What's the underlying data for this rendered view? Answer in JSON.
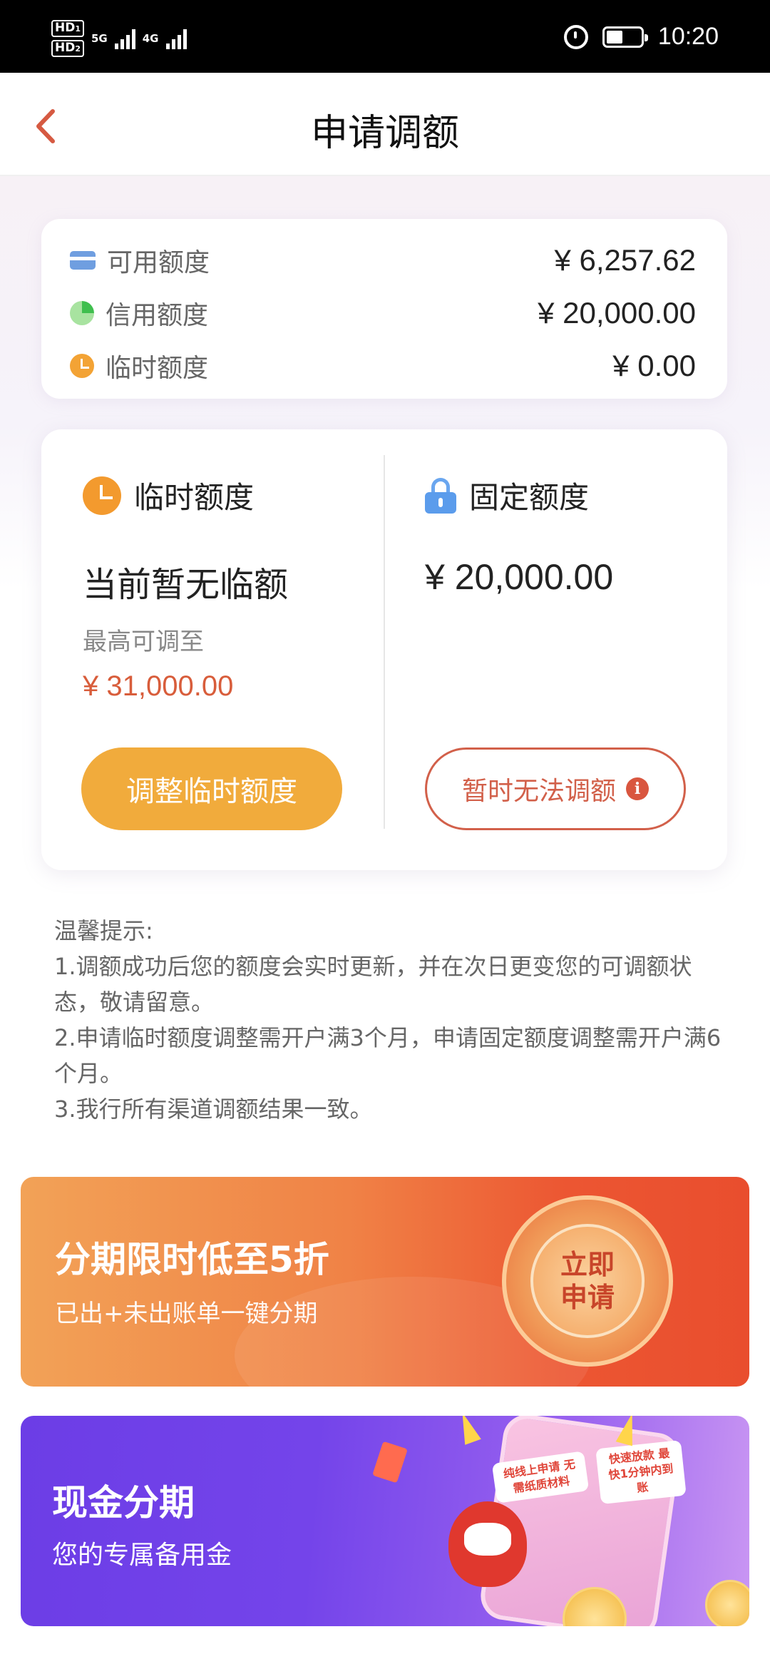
{
  "status_bar": {
    "hd1": "HD",
    "hd1_sub": "1",
    "hd2": "HD",
    "hd2_sub": "2",
    "net1": "5G",
    "net2": "4G",
    "time": "10:20"
  },
  "header": {
    "title": "申请调额",
    "back_icon": "chevron-left-icon"
  },
  "summary": {
    "items": [
      {
        "icon": "card-icon",
        "label": "可用额度",
        "value": "¥ 6,257.62"
      },
      {
        "icon": "pie-icon",
        "label": "信用额度",
        "value": "¥ 20,000.00"
      },
      {
        "icon": "clock-icon",
        "label": "临时额度",
        "value": "¥ 0.00"
      }
    ]
  },
  "adjust": {
    "temp": {
      "title": "临时额度",
      "status": "当前暂无临额",
      "max_label": "最高可调至",
      "max_value": "¥ 31,000.00",
      "button": "调整临时额度"
    },
    "fixed": {
      "title": "固定额度",
      "value": "¥ 20,000.00",
      "button": "暂时无法调额",
      "info_glyph": "i"
    }
  },
  "tips": {
    "title": "温馨提示:",
    "items": [
      "1.调额成功后您的额度会实时更新，并在次日更变您的可调额状态，敬请留意。",
      "2.申请临时额度调整需开户满3个月，申请固定额度调整需开户满6个月。",
      "3.我行所有渠道调额结果一致。"
    ]
  },
  "banners": {
    "installment": {
      "title": "分期限时低至5折",
      "subtitle": "已出+未出账单一键分期",
      "badge": "立即申请"
    },
    "cash": {
      "title": "现金分期",
      "subtitle": "您的专属备用金",
      "tag1": "纯线上申请 无需纸质材料",
      "tag2": "快速放款 最快1分钟内到账"
    }
  },
  "colors": {
    "accent_orange": "#f1ab3c",
    "accent_red": "#d2604a",
    "banner_orange": "#ec5632",
    "banner_purple": "#7444ea"
  }
}
